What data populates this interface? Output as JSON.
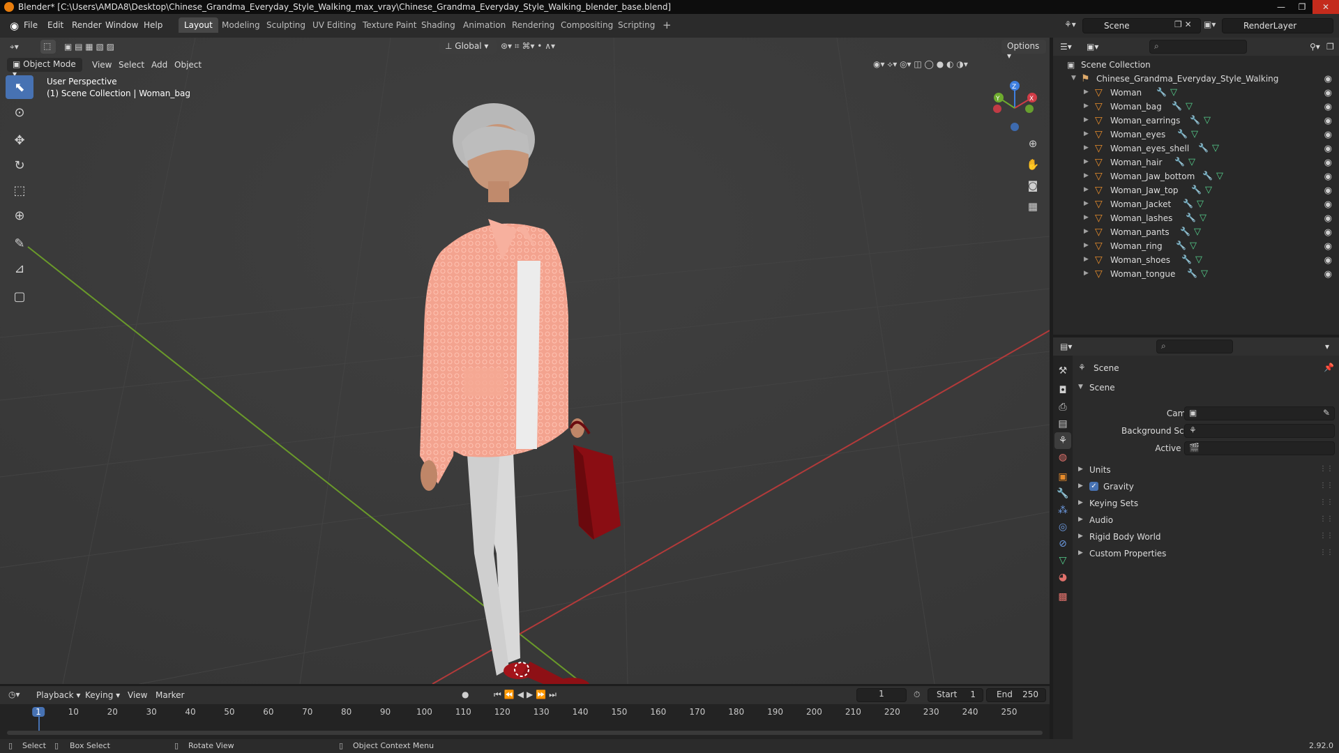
{
  "window": {
    "title": "Blender* [C:\\Users\\AMDA8\\Desktop\\Chinese_Grandma_Everyday_Style_Walking_max_vray\\Chinese_Grandma_Everyday_Style_Walking_blender_base.blend]",
    "minimize": "—",
    "maximize": "❐",
    "close": "✕"
  },
  "menu": [
    "File",
    "Edit",
    "Render",
    "Window",
    "Help"
  ],
  "workspaces": [
    "Layout",
    "Modeling",
    "Sculpting",
    "UV Editing",
    "Texture Paint",
    "Shading",
    "Animation",
    "Rendering",
    "Compositing",
    "Scripting"
  ],
  "add_workspace": "+",
  "scene_name": "Scene",
  "view_layer": "RenderLayer",
  "viewport": {
    "mode": "Object Mode",
    "menus": [
      "View",
      "Select",
      "Add",
      "Object"
    ],
    "orientation": "Global",
    "options": "Options",
    "perspective": "User Perspective",
    "collection_info": "(1) Scene Collection | Woman_bag"
  },
  "gizmo": {
    "x": "X",
    "y": "Y",
    "z": "Z"
  },
  "outliner": {
    "root": "Scene Collection",
    "collection": "Chinese_Grandma_Everyday_Style_Walking",
    "objects": [
      "Woman",
      "Woman_bag",
      "Woman_earrings",
      "Woman_eyes",
      "Woman_eyes_shell",
      "Woman_hair",
      "Woman_Jaw_bottom",
      "Woman_Jaw_top",
      "Woman_Jacket",
      "Woman_lashes",
      "Woman_pants",
      "Woman_ring",
      "Woman_shoes",
      "Woman_tongue"
    ]
  },
  "properties": {
    "context": "Scene",
    "section": "Scene",
    "fields": {
      "camera": "Camera",
      "background_scene": "Background Scene",
      "active_clip": "Active Clip"
    },
    "panels": [
      "Units",
      "Gravity",
      "Keying Sets",
      "Audio",
      "Rigid Body World",
      "Custom Properties"
    ],
    "gravity_checked": true
  },
  "timeline": {
    "menus": [
      "Playback",
      "Keying",
      "View",
      "Marker"
    ],
    "current_frame": "1",
    "start_label": "Start",
    "start": "1",
    "end_label": "End",
    "end": "250",
    "ticks": [
      "1",
      "10",
      "20",
      "30",
      "40",
      "50",
      "60",
      "70",
      "80",
      "90",
      "100",
      "110",
      "120",
      "130",
      "140",
      "150",
      "160",
      "170",
      "180",
      "190",
      "200",
      "210",
      "220",
      "230",
      "240",
      "250"
    ]
  },
  "status": {
    "select": "Select",
    "box_select": "Box Select",
    "rotate": "Rotate View",
    "context_menu": "Object Context Menu",
    "version": "2.92.0"
  },
  "colors": {
    "accent": "#4772b3",
    "object_orange": "#e58b2b",
    "x_axis": "#d03c47",
    "y_axis": "#6eab2e",
    "z_axis": "#3e7fe0"
  }
}
